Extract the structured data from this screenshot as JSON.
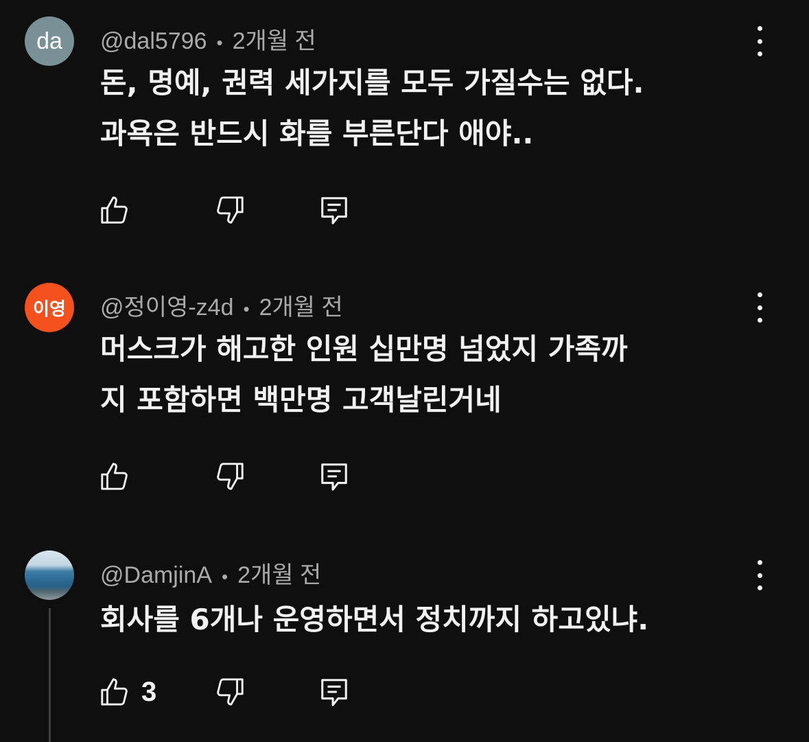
{
  "comments": [
    {
      "avatar_text": "da",
      "handle": "@dal5796",
      "time": "2개월 전",
      "lines": [
        "돈, 명예, 권력 세가지를 모두 가질수는 없다.",
        "과욕은 반드시 화를 부른단다 애야.."
      ],
      "likes": ""
    },
    {
      "avatar_text": "이영",
      "handle": "@정이영-z4d",
      "time": "2개월 전",
      "lines": [
        "머스크가 해고한 인원 십만명 넘었지 가족까",
        "지 포함하면 백만명 고객날린거네"
      ],
      "likes": ""
    },
    {
      "avatar_text": "",
      "handle": "@DamjinA",
      "time": "2개월 전",
      "lines": [
        "회사를 6개나 운영하면서 정치까지 하고있냐."
      ],
      "likes": "3"
    }
  ],
  "separator": "•",
  "colors": {
    "background": "#0f0f0f",
    "text": "#f1f1f1",
    "meta": "#aaaaaa",
    "avatar_gray": "#7a9097",
    "avatar_orange": "#f4511e"
  },
  "icons": [
    "thumbs-up-icon",
    "thumbs-down-icon",
    "reply-icon",
    "more-vertical-icon"
  ]
}
